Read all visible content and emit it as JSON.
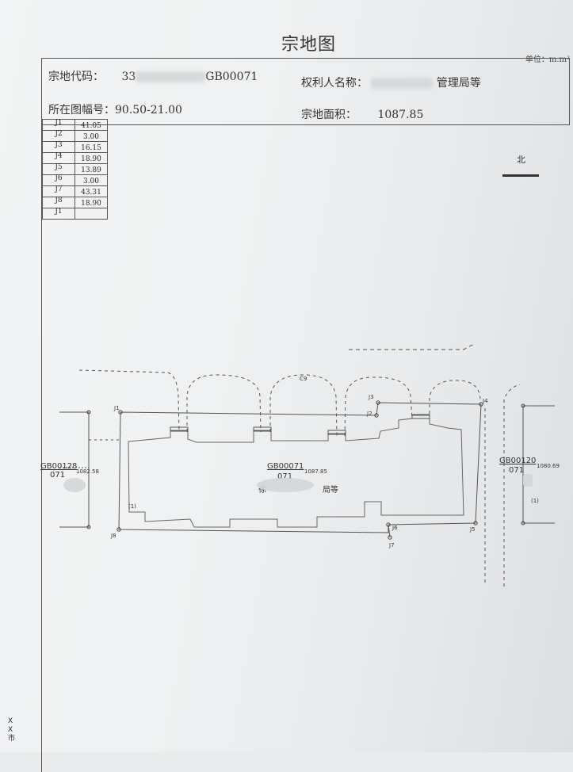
{
  "title": "宗地图",
  "unit": "单位：m.m²",
  "header": {
    "parcel_code_label": "宗地代码：",
    "parcel_code_prefix": "33",
    "parcel_code_suffix": "GB00071",
    "owner_label": "权利人名称：",
    "owner_value": "管理局等",
    "sheet_label": "所在图幅号：",
    "sheet_value": "90.50-21.00",
    "area_label": "宗地面积：",
    "area_value": "1087.85"
  },
  "boundary_table": {
    "points": [
      "J1",
      "J2",
      "J3",
      "J4",
      "J5",
      "J6",
      "J7",
      "J8",
      "J1"
    ],
    "distances": [
      "41.05",
      "3.00",
      "16.15",
      "18.90",
      "13.89",
      "3.00",
      "43.31",
      "18.90"
    ]
  },
  "north_label": "北",
  "map": {
    "labels": {
      "j1": "J1",
      "j2": "J2",
      "j3": "J3",
      "j4": "J4",
      "j5": "J5",
      "j6": "J6",
      "j7": "J7",
      "j8": "J8",
      "structure_mark": "(1)",
      "structure_mark_right": "(1)",
      "top_mark": "C9"
    },
    "main_parcel": {
      "code": "GB00071",
      "area": "1087.85",
      "sub_code": "071",
      "owner_prefix": "徐",
      "owner_suffix": "局等"
    },
    "left_parcel": {
      "code": "GB00128",
      "area": "1082.58",
      "sub_code": "071"
    },
    "right_parcel": {
      "code": "GB00120",
      "area": "1080.69",
      "sub_code": "071"
    }
  },
  "side_text": "X X 市"
}
